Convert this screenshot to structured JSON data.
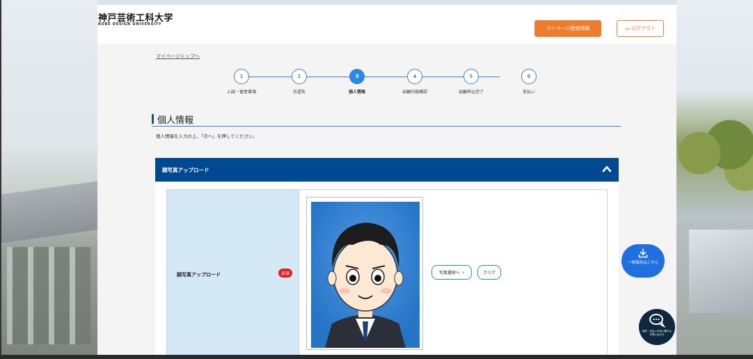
{
  "header": {
    "logo_jp": "神戸芸術工科大学",
    "logo_en": "KOBE DESIGN UNIVERSITY",
    "mypage_button": "マイページ登録情報",
    "logout_button": "ログアウト"
  },
  "nav": {
    "top_link": "マイページトップへ"
  },
  "stepper": {
    "active_step": 3,
    "steps": [
      {
        "number": "1",
        "label": "入試・留意事項"
      },
      {
        "number": "2",
        "label": "志望先"
      },
      {
        "number": "3",
        "label": "個人情報"
      },
      {
        "number": "4",
        "label": "出願内容確認"
      },
      {
        "number": "5",
        "label": "出願申込完了"
      },
      {
        "number": "6",
        "label": "支払い"
      }
    ]
  },
  "section": {
    "title": "個人情報",
    "instruction": "個人情報を入力の上、「次へ」を押してください。"
  },
  "photo_upload": {
    "header": "顔写真アップロード",
    "field_label": "顔写真アップロード",
    "required_badge": "必須",
    "select_button": "写真選択へ",
    "clear_button": "クリア"
  },
  "floating": {
    "save_label": "一時保存はこちら",
    "chat_label": "操作・支払い方法に関するお問い合わせ"
  },
  "colors": {
    "accent_orange": "#ef7b2d",
    "header_navy": "#00488f",
    "step_blue": "#2b8ae0",
    "required_red": "#e02020"
  }
}
